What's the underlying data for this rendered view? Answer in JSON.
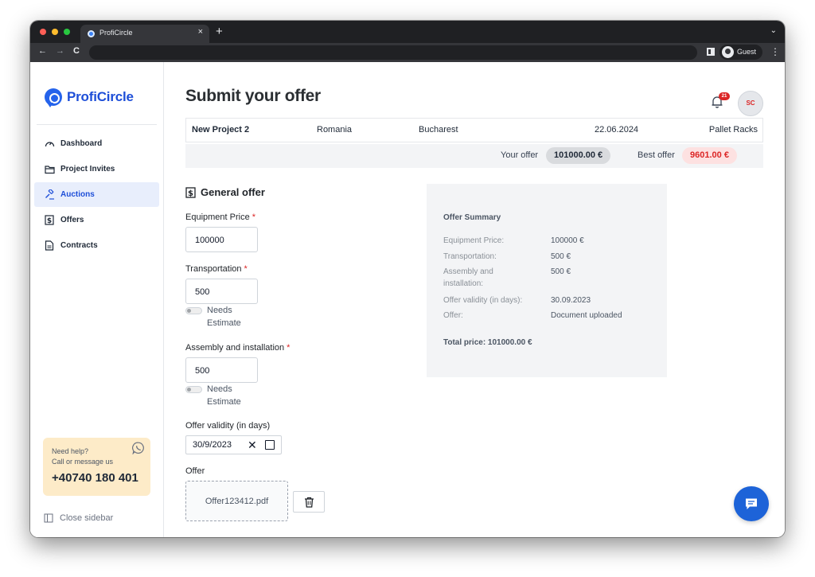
{
  "browser": {
    "tab_title": "ProfiCircle",
    "tab_close": "×",
    "new_tab": "+",
    "tab_menu": "⌄",
    "back": "←",
    "forward": "→",
    "reload": "C",
    "profile_label": "Guest",
    "menu": "⋮"
  },
  "sidebar": {
    "logo_text": "ProfiCircle",
    "items": [
      {
        "label": "Dashboard",
        "icon": "gauge-icon",
        "active": false
      },
      {
        "label": "Project Invites",
        "icon": "folder-icon",
        "active": false
      },
      {
        "label": "Auctions",
        "icon": "gavel-icon",
        "active": true
      },
      {
        "label": "Offers",
        "icon": "dollar-doc-icon",
        "active": false
      },
      {
        "label": "Contracts",
        "icon": "document-icon",
        "active": false
      }
    ],
    "help": {
      "title": "Need help?",
      "subtitle": "Call or message us",
      "phone": "+40740 180 401"
    },
    "close_label": "Close sidebar"
  },
  "header": {
    "title": "Submit your offer",
    "notification_count": "21",
    "avatar_initials": "SC"
  },
  "project": {
    "name": "New Project 2",
    "country": "Romania",
    "city": "Bucharest",
    "date": "22.06.2024",
    "category": "Pallet Racks"
  },
  "offers": {
    "your_label": "Your offer",
    "your_value": "101000.00 €",
    "best_label": "Best offer",
    "best_value": "9601.00 €"
  },
  "form": {
    "section_title": "General offer",
    "equipment_label": "Equipment Price",
    "equipment_value": "100000",
    "transport_label": "Transportation",
    "transport_value": "500",
    "assembly_label": "Assembly and installation",
    "assembly_value": "500",
    "required_mark": "*",
    "needs_line1": "Needs",
    "needs_line2": "Estimate",
    "validity_label": "Offer validity (in days)",
    "validity_value": "30/9/2023",
    "clear_glyph": "✕",
    "offer_label": "Offer",
    "offer_file": "Offer123412.pdf"
  },
  "summary": {
    "title": "Offer Summary",
    "rows": [
      {
        "key": "Equipment Price:",
        "value": "100000 €"
      },
      {
        "key": "Transportation:",
        "value": "500 €"
      },
      {
        "key": "Assembly and installation:",
        "value": "500 €"
      },
      {
        "key": "Offer validity (in days):",
        "value": "30.09.2023"
      },
      {
        "key": "Offer:",
        "value": "Document uploaded"
      }
    ],
    "total": "Total price: 101000.00 €"
  },
  "colors": {
    "brand": "#1d4ed8",
    "danger": "#dc2626",
    "help_bg": "#fdebc8"
  }
}
